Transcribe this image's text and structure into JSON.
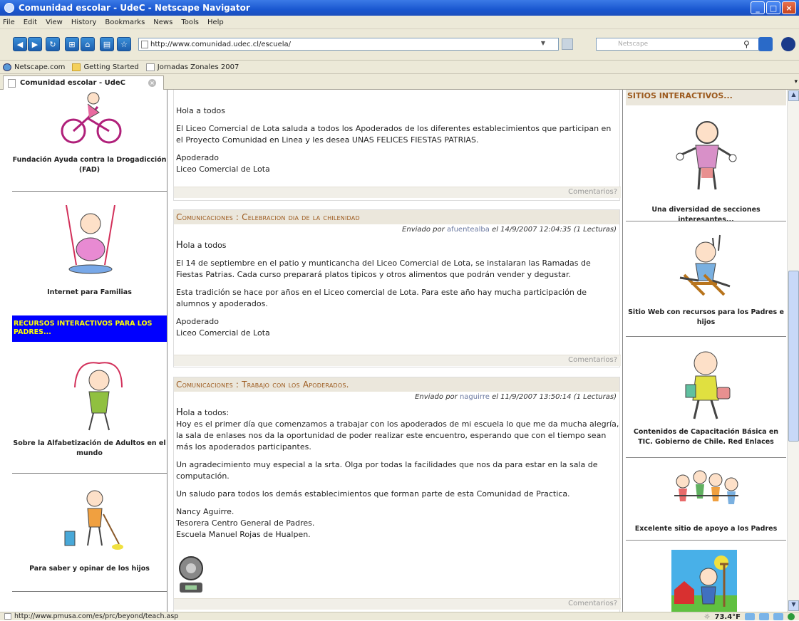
{
  "window": {
    "title": "Comunidad escolar - UdeC - Netscape Navigator"
  },
  "menu": [
    "File",
    "Edit",
    "View",
    "History",
    "Bookmarks",
    "News",
    "Tools",
    "Help"
  ],
  "nav": {
    "url": "http://www.comunidad.udec.cl/escuela/",
    "search_placeholder": "Netscape"
  },
  "bookmarks": [
    {
      "label": "Netscape.com",
      "icon": "globe-icon"
    },
    {
      "label": "Getting Started",
      "icon": "folder-icon"
    },
    {
      "label": "Jornadas Zonales 2007",
      "icon": "page-icon"
    }
  ],
  "tab": {
    "label": "Comunidad escolar - UdeC"
  },
  "left": {
    "items": [
      {
        "label": "Fundación Ayuda contra la Drogadicción (FAD)"
      },
      {
        "label": "Internet para Familias"
      },
      {
        "label": "Sobre la Alfabetización de Adultos en el mundo"
      },
      {
        "label": "Para saber y opinar de los hijos"
      }
    ],
    "section_header": "RECURSOS INTERACTIVOS PARA LOS PADRES..."
  },
  "posts": [
    {
      "paragraphs": [
        "Hola a todos",
        "El Liceo Comercial de Lota saluda a todos los Apoderados de los diferentes establecimientos que participan en el Proyecto Comunidad en Linea y les desea UNAS FELICES FIESTAS PATRIAS.",
        "Apoderado",
        "Liceo Comercial de Lota"
      ],
      "comments": "Comentarios?"
    },
    {
      "title": "Comunicaciones : Celebracion dia de la chilenidad",
      "meta_prefix": "Enviado por",
      "author": "afuentealba",
      "meta_suffix": "el 14/9/2007 12:04:35 (1 Lecturas)",
      "greeting_first": "H",
      "greeting_rest": "ola a todos",
      "paragraphs": [
        "El 14 de septiembre en el patio y munticancha del Liceo Comercial de Lota, se instalaran las Ramadas de Fiestas Patrias. Cada curso preparará platos tipicos y otros alimentos que podrán vender y degustar.",
        "Esta tradición se hace por años en el Liceo comercial de Lota. Para este año hay mucha participación de alumnos y apoderados.",
        "Apoderado",
        "Liceo Comercial de Lota"
      ],
      "comments": "Comentarios?"
    },
    {
      "title": "Comunicaciones : Trabajo con los Apoderados.",
      "meta_prefix": "Enviado por",
      "author": "naguirre",
      "meta_suffix": "el 11/9/2007 13:50:14 (1 Lecturas)",
      "greeting_first": "H",
      "greeting_rest": "ola a todos:",
      "paragraphs": [
        "Hoy es el primer día que comenzamos a trabajar con los apoderados de mi escuela lo que me da mucha alegría, la sala de enlases nos da la oportunidad de poder realizar este encuentro, esperando que con el tiempo sean más los apoderados participantes.",
        "Un agradecimiento muy especial a la srta. Olga por todas la facilidades que nos da para estar en la sala de computación.",
        "Un saludo para todos los demás establecimientos que forman parte de esta Comunidad de Practica.",
        "Nancy Aguirre.",
        "Tesorera Centro General de Padres.",
        "Escuela Manuel Rojas de Hualpen."
      ],
      "comments": "Comentarios?"
    }
  ],
  "right": {
    "header": "SITIOS INTERACTIVOS...",
    "items": [
      {
        "label": "Una diversidad de secciones interesantes..."
      },
      {
        "label": "Sitio Web con recursos para los Padres e hijos"
      },
      {
        "label": "Contenidos de Capacitación Básica en TIC. Gobierno de Chile. Red Enlaces"
      },
      {
        "label": "Excelente sitio de apoyo a los Padres"
      }
    ]
  },
  "status": {
    "url": "http://www.pmusa.com/es/prc/beyond/teach.asp",
    "temperature": "73.4°F"
  }
}
